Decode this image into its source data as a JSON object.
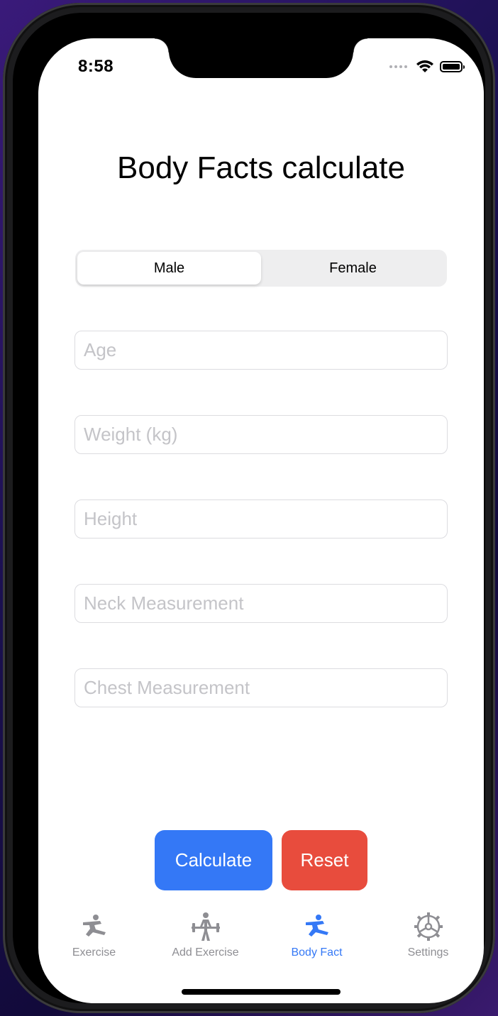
{
  "status_bar": {
    "time": "8:58"
  },
  "page": {
    "title": "Body Facts calculate"
  },
  "gender_segment": {
    "options": [
      "Male",
      "Female"
    ],
    "selected": "Male"
  },
  "form": {
    "age": {
      "placeholder": "Age",
      "value": ""
    },
    "weight": {
      "placeholder": "Weight (kg)",
      "value": ""
    },
    "height": {
      "placeholder": "Height",
      "value": ""
    },
    "neck": {
      "placeholder": "Neck Measurement",
      "value": ""
    },
    "chest": {
      "placeholder": "Chest Measurement",
      "value": ""
    }
  },
  "actions": {
    "calculate_label": "Calculate",
    "reset_label": "Reset",
    "calculate_color": "#3478f6",
    "reset_color": "#e84c3d"
  },
  "tab_bar": {
    "items": [
      {
        "label": "Exercise",
        "icon": "martial-arts-icon",
        "active": false
      },
      {
        "label": "Add Exercise",
        "icon": "weightlifter-icon",
        "active": false
      },
      {
        "label": "Body Fact",
        "icon": "martial-arts-icon",
        "active": true
      },
      {
        "label": "Settings",
        "icon": "gear-icon",
        "active": false
      }
    ],
    "active_color": "#3478f6",
    "inactive_color": "#8e8e93"
  }
}
